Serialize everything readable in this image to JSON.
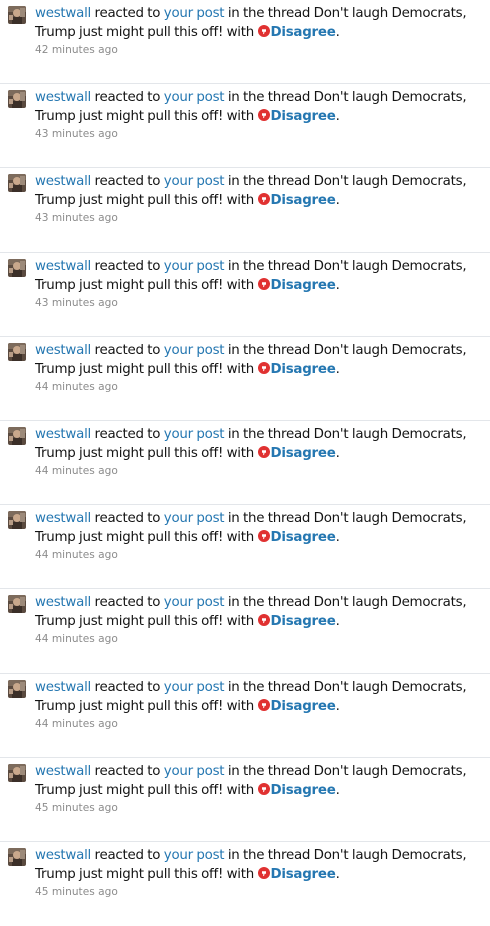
{
  "colors": {
    "link": "#2577b1",
    "text": "#141414",
    "muted": "#8c8c8c",
    "divider": "#e3e6ea",
    "reaction_icon": "#e03131"
  },
  "alerts": [
    {
      "user": "westwall",
      "verb": "reacted to",
      "target": "your post",
      "context": "in the thread Don't laugh Democrats, Trump just might pull this off! with",
      "reaction_icon": "disagree-icon",
      "reaction": "Disagree",
      "end": ".",
      "time": "42 minutes ago"
    },
    {
      "user": "westwall",
      "verb": "reacted to",
      "target": "your post",
      "context": "in the thread Don't laugh Democrats, Trump just might pull this off! with",
      "reaction_icon": "disagree-icon",
      "reaction": "Disagree",
      "end": ".",
      "time": "43 minutes ago"
    },
    {
      "user": "westwall",
      "verb": "reacted to",
      "target": "your post",
      "context": "in the thread Don't laugh Democrats, Trump just might pull this off! with",
      "reaction_icon": "disagree-icon",
      "reaction": "Disagree",
      "end": ".",
      "time": "43 minutes ago"
    },
    {
      "user": "westwall",
      "verb": "reacted to",
      "target": "your post",
      "context": "in the thread Don't laugh Democrats, Trump just might pull this off! with",
      "reaction_icon": "disagree-icon",
      "reaction": "Disagree",
      "end": ".",
      "time": "43 minutes ago"
    },
    {
      "user": "westwall",
      "verb": "reacted to",
      "target": "your post",
      "context": "in the thread Don't laugh Democrats, Trump just might pull this off! with",
      "reaction_icon": "disagree-icon",
      "reaction": "Disagree",
      "end": ".",
      "time": "44 minutes ago"
    },
    {
      "user": "westwall",
      "verb": "reacted to",
      "target": "your post",
      "context": "in the thread Don't laugh Democrats, Trump just might pull this off! with",
      "reaction_icon": "disagree-icon",
      "reaction": "Disagree",
      "end": ".",
      "time": "44 minutes ago"
    },
    {
      "user": "westwall",
      "verb": "reacted to",
      "target": "your post",
      "context": "in the thread Don't laugh Democrats, Trump just might pull this off! with",
      "reaction_icon": "disagree-icon",
      "reaction": "Disagree",
      "end": ".",
      "time": "44 minutes ago"
    },
    {
      "user": "westwall",
      "verb": "reacted to",
      "target": "your post",
      "context": "in the thread Don't laugh Democrats, Trump just might pull this off! with",
      "reaction_icon": "disagree-icon",
      "reaction": "Disagree",
      "end": ".",
      "time": "44 minutes ago"
    },
    {
      "user": "westwall",
      "verb": "reacted to",
      "target": "your post",
      "context": "in the thread Don't laugh Democrats, Trump just might pull this off! with",
      "reaction_icon": "disagree-icon",
      "reaction": "Disagree",
      "end": ".",
      "time": "44 minutes ago"
    },
    {
      "user": "westwall",
      "verb": "reacted to",
      "target": "your post",
      "context": "in the thread Don't laugh Democrats, Trump just might pull this off! with",
      "reaction_icon": "disagree-icon",
      "reaction": "Disagree",
      "end": ".",
      "time": "45 minutes ago"
    },
    {
      "user": "westwall",
      "verb": "reacted to",
      "target": "your post",
      "context": "in the thread Don't laugh Democrats, Trump just might pull this off! with",
      "reaction_icon": "disagree-icon",
      "reaction": "Disagree",
      "end": ".",
      "time": "45 minutes ago"
    }
  ]
}
